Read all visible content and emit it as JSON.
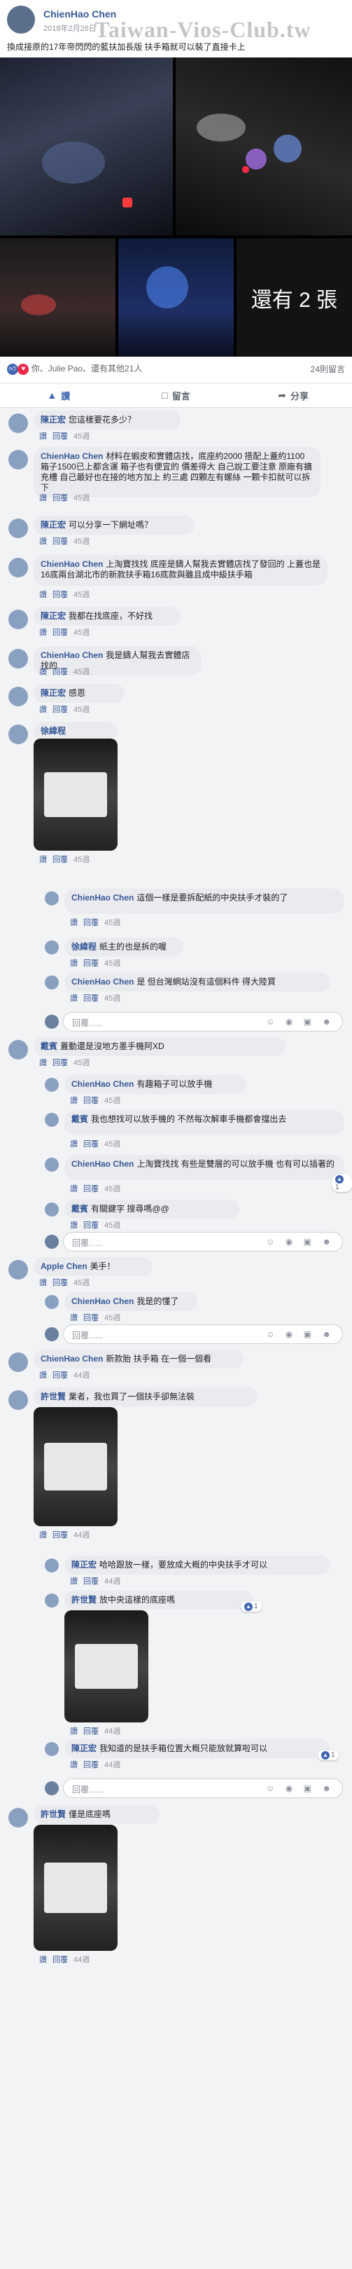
{
  "watermark": "Taiwan-Vios-Club.tw",
  "post": {
    "author": "ChienHao Chen",
    "date": "2018年2月26日",
    "text": "換成接原的17年帝閃閃的藍扶加長版 扶手箱就可以裝了直接卡上",
    "more_photos": "還有 2 張",
    "reactions_text": "你、Julie Pao、還有其他21人",
    "comment_count": "24則留言",
    "colors": {
      "link": "#385898",
      "meta": "#90949c",
      "like_blue": "#4267b2"
    }
  },
  "actions": {
    "like": "讚",
    "comment": "留言",
    "share": "分享"
  },
  "reply_placeholder": "回覆......",
  "reply_icons": "☺ ◉ ▣ ☻",
  "comments": [
    {
      "name": "陳正宏",
      "text": "您這樣要花多少？",
      "like": "讚",
      "reply": "回覆",
      "time": "45週"
    },
    {
      "name": "ChienHao Chen",
      "text": "材料在蝦皮和實體店找，底座約2000 搭配上蓋約1100 箱子1500已上都含運 箱子也有便宜的 價差得大 自己說工要注意 原廠有擴充槽 自己最好也在接的地方加上 約三處 四顆左有螺絲 一顆卡扣就可以拆下",
      "like": "讚",
      "reply": "回覆",
      "time": "45週"
    },
    {
      "name": "陳正宏",
      "text": "可以分享一下網址嗎？",
      "like": "讚",
      "reply": "回覆",
      "time": "45週"
    },
    {
      "name": "ChienHao Chen",
      "text": "上淘寶找找 底座是鑄人幫我去實體店找了發回的 上蓋也是16底兩台湖北市的新款扶手箱16底款與雖且成中級扶手箱",
      "like": "讚",
      "reply": "回覆",
      "time": "45週"
    },
    {
      "name": "陳正宏",
      "text": "我都在找底座，不好找",
      "like": "讚",
      "reply": "回覆",
      "time": "45週"
    },
    {
      "name": "ChienHao Chen",
      "text": "我是鑄人幫我去實體店找的",
      "like": "讚",
      "reply": "回覆",
      "time": "45週"
    },
    {
      "name": "陳正宏",
      "text": "感恩",
      "like": "讚",
      "reply": "回覆",
      "time": "45週"
    },
    {
      "name": "徐緯程",
      "text": "",
      "like": "讚",
      "reply": "回覆",
      "time": "45週"
    }
  ],
  "thread_replies_1": [
    {
      "name": "ChienHao Chen",
      "text": "這個一樣是要拆配紙的中央扶手才裝的了",
      "time": "45週"
    },
    {
      "name": "徐緯程",
      "text": "紙主的也是拆的喔",
      "time": "45週"
    },
    {
      "name": "ChienHao Chen",
      "text": "是 但台灣網站沒有這個料件 得大陸買",
      "time": "45週"
    }
  ],
  "c_yan": {
    "name": "戴賓",
    "text": "蓋動還是沒地方墨手機阿XD",
    "time": "45週"
  },
  "thread_replies_2": [
    {
      "name": "ChienHao Chen",
      "text": "有趣箱子可以放手機",
      "time": "45週"
    },
    {
      "name": "戴賓",
      "text": "我也想找可以放手機的 不然每次解車手機都會擋出去",
      "time": "45週"
    },
    {
      "name": "ChienHao Chen",
      "text": "上淘寶找找 有些是雙層的可以放手機 也有可以插著的",
      "time": "45週",
      "likes": "1"
    },
    {
      "name": "戴賓",
      "text": "有關鍵字 搜尋嗎@@",
      "time": "45週"
    }
  ],
  "c_apple": {
    "name": "Apple Chen",
    "text": "美手！",
    "time": "45週"
  },
  "thread_replies_3": [
    {
      "name": "ChienHao Chen",
      "text": "我是的懂了",
      "time": "45週"
    }
  ],
  "c_new": {
    "name": "ChienHao Chen",
    "text": "新款胎 扶手箱 在一個一個看",
    "time": "44週"
  },
  "c_xu": {
    "name": "許世賢",
    "text": "業者，我也買了一個扶手卻無法裝",
    "time": "44週"
  },
  "thread_replies_4": [
    {
      "name": "陳正宏",
      "text": "哈哈跟放一樣，要放成大概的中央扶手才可以",
      "time": "44週"
    },
    {
      "name": "許世賢",
      "text": "放中央這樣的底座嗎",
      "time": "44週",
      "likes": "1"
    },
    {
      "name": "陳正宏",
      "text": "我知道的是扶手箱位置大概只能放就算啦可以",
      "time": "44週",
      "likes": "1"
    }
  ],
  "c_xu2": {
    "name": "許世賢",
    "text": "僅是底座嗎",
    "time": "44週"
  }
}
